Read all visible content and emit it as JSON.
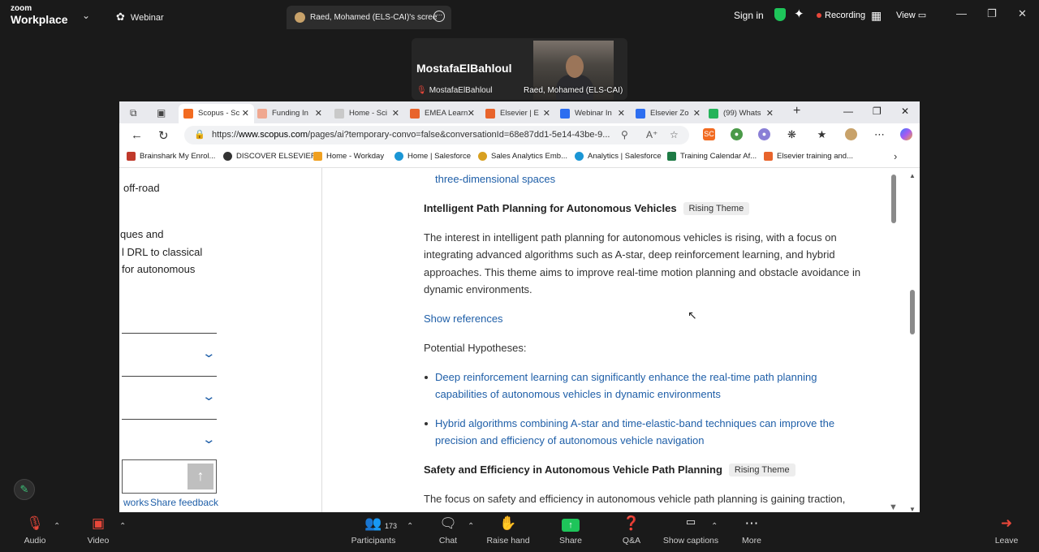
{
  "zoom_top": {
    "logo_line1": "zoom",
    "logo_line2": "Workplace",
    "webinar": "Webinar",
    "share_tab": "Raed, Mohamed (ELS-CAI)'s scree",
    "sign_in": "Sign in",
    "recording": "Recording",
    "view": "View",
    "colors": {
      "recording_dot": "#e8473a",
      "shield": "#1ec55a"
    }
  },
  "videos": {
    "speaker_name": "MostafaElBahloul",
    "speaker_label": "MostafaElBahloul",
    "camera_label": "Raed, Mohamed (ELS-CAI)"
  },
  "browser": {
    "tabs": [
      {
        "label": "Scopus - Sc",
        "icon": "SC",
        "color": "#f26b21"
      },
      {
        "label": "Funding In",
        "icon": "E",
        "color": "#f0a890"
      },
      {
        "label": "Home - Sci",
        "icon": "SV",
        "color": "#c9c9c9"
      },
      {
        "label": "EMEA Learn",
        "icon": "E",
        "color": "#e8642c"
      },
      {
        "label": "Elsevier | E",
        "icon": "E",
        "color": "#e8642c"
      },
      {
        "label": "Webinar In",
        "icon": "zm",
        "color": "#2d6ef0"
      },
      {
        "label": "Elsevier Zo",
        "icon": "zm",
        "color": "#2d6ef0"
      },
      {
        "label": "(99) Whats",
        "icon": "wa",
        "color": "#25b35a"
      }
    ],
    "url_prefix": "https://",
    "url_domain": "www.scopus.com",
    "url_rest": "/pages/ai?temporary-convo=false&conversationId=68e87dd1-5e14-43be-9...",
    "bookmarks": [
      "Brainshark My Enrol...",
      "DISCOVER ELSEVIER",
      "Home - Workday",
      "Home | Salesforce",
      "Sales Analytics Emb...",
      "Analytics | Salesforce",
      "Training Calendar Af...",
      "Elsevier training and..."
    ]
  },
  "left_panel": {
    "line1": "off-road",
    "line2": "ques and",
    "line3": "l DRL to classical",
    "line4": "for autonomous",
    "footer_link1": "works",
    "footer_link2": "Share feedback"
  },
  "main": {
    "prev_tail": "three-dimensional spaces",
    "theme1_title": "Intelligent Path Planning for Autonomous Vehicles",
    "theme1_badge": "Rising Theme",
    "theme1_p1": "The interest in intelligent path planning for autonomous vehicles is rising, with a focus on",
    "theme1_p2": "integrating advanced algorithms such as A-star, deep reinforcement learning, and hybrid",
    "theme1_p3": "approaches. This theme aims to improve real-time motion planning and obstacle avoidance in",
    "theme1_p4": "dynamic environments.",
    "show_refs": "Show references",
    "hypotheses_label": "Potential Hypotheses:",
    "hyp1_l1": "Deep reinforcement learning can significantly enhance the real-time path planning",
    "hyp1_l2": "capabilities of autonomous vehicles in dynamic environments",
    "hyp2_l1": "Hybrid algorithms combining A-star and time-elastic-band techniques can improve the",
    "hyp2_l2": "precision and efficiency of autonomous vehicle navigation",
    "theme2_title": "Safety and Efficiency in Autonomous Vehicle Path Planning",
    "theme2_badge": "Rising Theme",
    "theme2_p1": "The focus on safety and efficiency in autonomous vehicle path planning is gaining traction,"
  },
  "zoom_bottom": {
    "audio": "Audio",
    "video": "Video",
    "participants": "Participants",
    "participants_count": "173",
    "chat": "Chat",
    "raise_hand": "Raise hand",
    "share": "Share",
    "qa": "Q&A",
    "captions": "Show captions",
    "more": "More",
    "leave": "Leave"
  }
}
